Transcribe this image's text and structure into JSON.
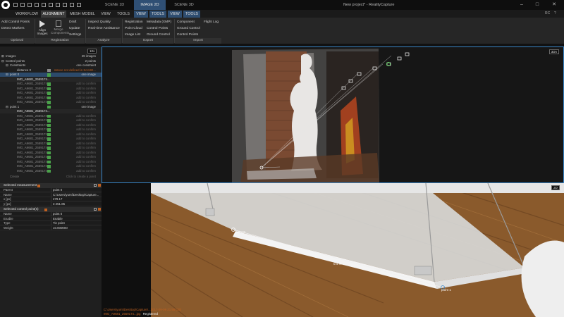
{
  "window": {
    "title": "New project* - RealityCapture",
    "scene_tabs": [
      "SCENE 1D",
      "IMAGE 2D",
      "SCENE 3D"
    ],
    "controls": [
      "–",
      "□",
      "✕"
    ],
    "flags": "RC",
    "help": "?"
  },
  "ribbon": {
    "tabs": [
      "WORKFLOW",
      "ALIGNMENT",
      "MESH MODEL",
      "VIEW",
      "TOOLS"
    ],
    "context_tabs": [
      "VIEW",
      "TOOLS",
      "VIEW",
      "TOOLS"
    ],
    "col1": [
      "Add Control Points",
      "Detect Markers"
    ],
    "align_btn": "Align Images",
    "merge_btn": "Merge Components",
    "col3": [
      "Draft",
      "Update",
      "Settings"
    ],
    "col4": [
      "Inspect Quality",
      "Real-time Assistance"
    ],
    "col5": [
      "Registration",
      "Point Cloud",
      "Image List"
    ],
    "col6": [
      "Metadata (XMP)",
      "Control Points",
      "Ground Control"
    ],
    "col7": [
      "Component",
      "Ground Control",
      "Control Points"
    ],
    "col8": [
      "Flight Log"
    ],
    "groups": [
      "Optional",
      "Registration",
      "Analyze",
      "Export",
      "Import"
    ]
  },
  "left": {
    "badge": "10x",
    "images": {
      "label": "Images",
      "value": "29 images"
    },
    "control_points": {
      "label": "Control points",
      "value": "2 points"
    },
    "constraints": {
      "label": "Constraints",
      "value": "one constraint"
    },
    "distance": {
      "label": "distance 0",
      "value": "stance not defined in ScASE..."
    },
    "point0": {
      "label": "point 0",
      "value": "one image"
    },
    "point0_img": "IMG_A9681_2559174...",
    "img_rows": [
      "IMG_A9681_2559174...",
      "IMG_A9681_2559174...",
      "IMG_A9681_2559174...",
      "IMG_A9681_2559174...",
      "IMG_A9681_2559174..."
    ],
    "point1": {
      "label": "point 1",
      "value": "one image"
    },
    "point1_img": "IMG_A9681_2559174...",
    "img_rows2": [
      "IMG_A9681_2559174...",
      "IMG_A9681_2559174...",
      "IMG_A9681_2559174...",
      "IMG_A9681_2559174...",
      "IMG_A9681_2559174...",
      "IMG_A9681_2559174...",
      "IMG_A9681_2559174...",
      "IMG_A9681_2559174...",
      "IMG_A9681_2559174...",
      "IMG_A9681_2559174...",
      "IMG_A9681_2559174...",
      "IMG_A9681_2559174...",
      "IMG_A9681_2559174..."
    ],
    "add_to_confirm": "add to confirm",
    "create": "Create",
    "create_hint": "Click to create a point"
  },
  "selected_measurement": {
    "title": "Selected measurement",
    "rows": [
      {
        "k": "Parent",
        "v": "point 0"
      },
      {
        "k": "Name",
        "v": "C:\\Users\\yumi\\Desktop\\Capture..."
      },
      {
        "k": "x [px]",
        "v": "279.17"
      },
      {
        "k": "y [px]",
        "v": "3 251.85"
      }
    ]
  },
  "selected_cp": {
    "title": "Selected control point(s)",
    "rows": [
      {
        "k": "Name",
        "v": "point 0"
      },
      {
        "k": "Enable",
        "v": "Enable"
      },
      {
        "k": "Type",
        "v": "Tie point"
      },
      {
        "k": "Weight",
        "v": "10.000000"
      }
    ]
  },
  "view3d": {
    "badge": "3Dn"
  },
  "view2d": {
    "badge": "2D",
    "p0": "point 0",
    "p1": "point 1",
    "distance": "0.4 m",
    "path": "C:\\Users\\yumi\\Desktop\\Capture\\...2017-09-09 21:58 [15]",
    "file": "IMG_A9681_2559174...jpg",
    "status": "Registered"
  },
  "colors": {
    "accent": "#3a86c8",
    "check": "#4aa24a",
    "warn": "#c06020"
  }
}
